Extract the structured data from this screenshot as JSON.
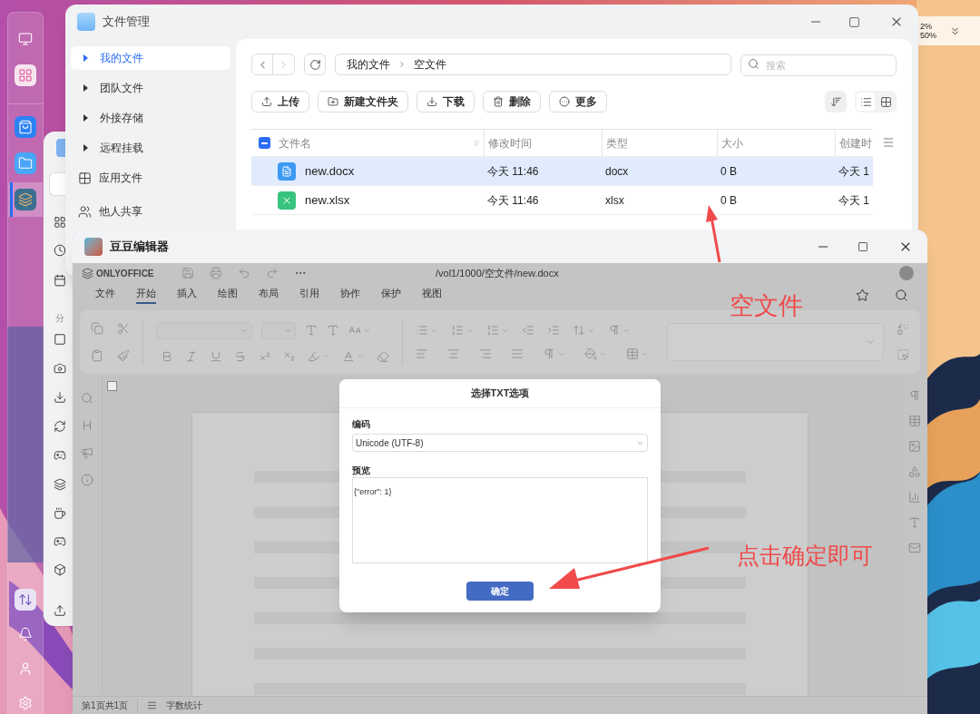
{
  "dock": {
    "top": [
      {
        "kind": "monitor",
        "selected": false
      },
      {
        "kind": "apps",
        "selected": false
      },
      {
        "kind": "store",
        "selected": false
      },
      {
        "kind": "files",
        "selected": false
      },
      {
        "kind": "editor",
        "selected": true
      }
    ],
    "bottom": [
      {
        "kind": "transfer",
        "selected": false
      },
      {
        "kind": "bell",
        "selected": false
      },
      {
        "kind": "user",
        "selected": false
      },
      {
        "kind": "settings",
        "selected": false
      }
    ]
  },
  "tray": {
    "lines": [
      "2%",
      "50%"
    ]
  },
  "back_window": {
    "section_label": "分"
  },
  "file_manager": {
    "title": "文件管理",
    "sidebar": [
      {
        "label": "我的文件",
        "kind": "expandable",
        "selected": true
      },
      {
        "label": "团队文件",
        "kind": "expandable",
        "selected": false
      },
      {
        "label": "外接存储",
        "kind": "expandable",
        "selected": false
      },
      {
        "label": "远程挂载",
        "kind": "expandable",
        "selected": false
      },
      {
        "label": "应用文件",
        "kind": "apps",
        "selected": false
      },
      {
        "label": "他人共享",
        "kind": "shared",
        "selected": false
      }
    ],
    "breadcrumb": [
      "我的文件",
      "空文件"
    ],
    "search": {
      "placeholder": "搜索"
    },
    "toolbar": [
      {
        "label": "上传",
        "kind": "upload"
      },
      {
        "label": "新建文件夹",
        "kind": "new-folder"
      },
      {
        "label": "下载",
        "kind": "download"
      },
      {
        "label": "删除",
        "kind": "delete"
      },
      {
        "label": "更多",
        "kind": "more"
      }
    ],
    "view_buttons": [
      {
        "kind": "list",
        "selected": true
      },
      {
        "kind": "grid",
        "selected": false
      }
    ],
    "table": {
      "select_all": {
        "indeterminate": true
      },
      "columns": [
        "文件名",
        "修改时间",
        "类型",
        "大小",
        "创建时"
      ],
      "rows": [
        {
          "name": "new.docx",
          "kind": "word",
          "modified": "今天 11:46",
          "type": "docx",
          "size": "0 B",
          "created": "今天 1",
          "selected": true
        },
        {
          "name": "new.xlsx",
          "kind": "sheet",
          "modified": "今天 11:46",
          "type": "xlsx",
          "size": "0 B",
          "created": "今天 1",
          "selected": false
        }
      ]
    }
  },
  "editor": {
    "title": "豆豆编辑器",
    "brand": "ONLYOFFICE",
    "path": "/vol1/1000/空文件/new.docx",
    "menu": [
      {
        "label": "文件",
        "selected": false
      },
      {
        "label": "开始",
        "selected": true
      },
      {
        "label": "插入",
        "selected": false
      },
      {
        "label": "绘图",
        "selected": false
      },
      {
        "label": "布局",
        "selected": false
      },
      {
        "label": "引用",
        "selected": false
      },
      {
        "label": "协作",
        "selected": false
      },
      {
        "label": "保护",
        "selected": false
      },
      {
        "label": "视图",
        "selected": false
      }
    ],
    "status": [
      "第1页共1页",
      "字数统计"
    ]
  },
  "dialog": {
    "title": "选择TXT选项",
    "encoding_label": "编码",
    "encoding_value": "Unicode (UTF-8)",
    "preview_label": "预览",
    "preview_text": "{\"error\": 1}",
    "ok": "确定"
  },
  "annotations": [
    {
      "text": "空文件"
    },
    {
      "text": "点击确定即可"
    }
  ]
}
